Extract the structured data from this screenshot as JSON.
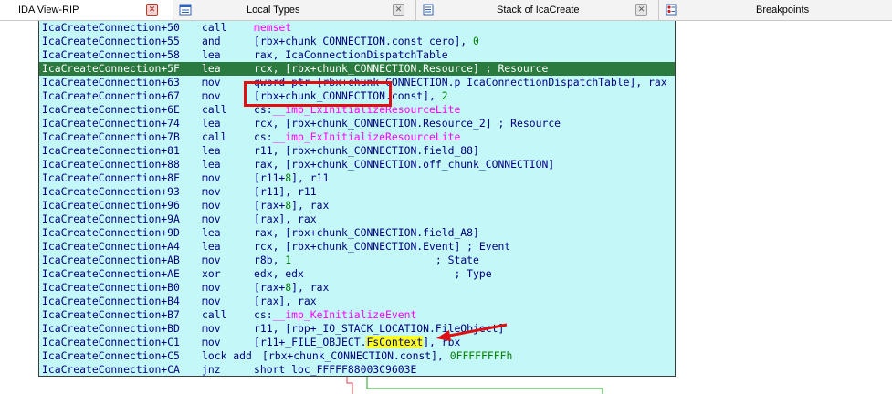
{
  "tabs": [
    {
      "label": "IDA View-RIP",
      "active": true,
      "icon": "none"
    },
    {
      "label": "Local Types",
      "active": false,
      "icon": "local-types-icon"
    },
    {
      "label": "Stack of IcaCreate",
      "active": false,
      "icon": "stack-icon"
    },
    {
      "label": "Breakpoints",
      "active": false,
      "icon": "breakpoints-icon"
    }
  ],
  "colors": {
    "node_bg": "#c4f8f8",
    "highlight": "#2b7a3f",
    "text": "#000080",
    "import": "#ff00ff",
    "number": "#008000",
    "marker": "#e01010"
  },
  "disasm": [
    {
      "addr": "IcaCreateConnection+50",
      "mnem": "call",
      "ops": [
        {
          "t": "memset",
          "c": "fn"
        }
      ]
    },
    {
      "addr": "IcaCreateConnection+55",
      "mnem": "and",
      "ops": [
        {
          "t": "[rbx+chunk_CONNECTION.const_cero], "
        },
        {
          "t": "0",
          "c": "num"
        }
      ]
    },
    {
      "addr": "IcaCreateConnection+58",
      "mnem": "lea",
      "ops": [
        {
          "t": "rax, IcaConnectionDispatchTable"
        }
      ]
    },
    {
      "addr": "IcaCreateConnection+5F",
      "mnem": "lea",
      "highlight": true,
      "ops": [
        {
          "t": "rcx, [rbx+chunk_CONNECTION.Resource] ; Resource"
        }
      ]
    },
    {
      "addr": "IcaCreateConnection+63",
      "mnem": "mov",
      "ops": [
        {
          "t": "qword ptr [rbx+chunk_CONNECTION.p_IcaConnectionDispatchTable], rax"
        }
      ]
    },
    {
      "addr": "IcaCreateConnection+67",
      "mnem": "mov",
      "ops": [
        {
          "t": "[rbx+chunk_CONNECTION.const], "
        },
        {
          "t": "2",
          "c": "num"
        }
      ]
    },
    {
      "addr": "IcaCreateConnection+6E",
      "mnem": "call",
      "ops": [
        {
          "t": "cs:"
        },
        {
          "t": "__imp_ExInitializeResourceLite",
          "c": "fn"
        }
      ]
    },
    {
      "addr": "IcaCreateConnection+74",
      "mnem": "lea",
      "ops": [
        {
          "t": "rcx, [rbx+chunk_CONNECTION.Resource_2] ; Resource"
        }
      ]
    },
    {
      "addr": "IcaCreateConnection+7B",
      "mnem": "call",
      "ops": [
        {
          "t": "cs:"
        },
        {
          "t": "__imp_ExInitializeResourceLite",
          "c": "fn"
        }
      ]
    },
    {
      "addr": "IcaCreateConnection+81",
      "mnem": "lea",
      "ops": [
        {
          "t": "r11, [rbx+chunk_CONNECTION.field_88]"
        }
      ]
    },
    {
      "addr": "IcaCreateConnection+88",
      "mnem": "lea",
      "ops": [
        {
          "t": "rax, [rbx+chunk_CONNECTION.off_chunk_CONNECTION]"
        }
      ]
    },
    {
      "addr": "IcaCreateConnection+8F",
      "mnem": "mov",
      "ops": [
        {
          "t": "[r11+"
        },
        {
          "t": "8",
          "c": "num"
        },
        {
          "t": "], r11"
        }
      ]
    },
    {
      "addr": "IcaCreateConnection+93",
      "mnem": "mov",
      "ops": [
        {
          "t": "[r11], r11"
        }
      ]
    },
    {
      "addr": "IcaCreateConnection+96",
      "mnem": "mov",
      "ops": [
        {
          "t": "[rax+"
        },
        {
          "t": "8",
          "c": "num"
        },
        {
          "t": "], rax"
        }
      ]
    },
    {
      "addr": "IcaCreateConnection+9A",
      "mnem": "mov",
      "ops": [
        {
          "t": "[rax], rax"
        }
      ]
    },
    {
      "addr": "IcaCreateConnection+9D",
      "mnem": "lea",
      "ops": [
        {
          "t": "rax, [rbx+chunk_CONNECTION.field_A8]"
        }
      ]
    },
    {
      "addr": "IcaCreateConnection+A4",
      "mnem": "lea",
      "ops": [
        {
          "t": "rcx, [rbx+chunk_CONNECTION.Event] ; Event"
        }
      ]
    },
    {
      "addr": "IcaCreateConnection+AB",
      "mnem": "mov",
      "ops": [
        {
          "t": "r8b, "
        },
        {
          "t": "1",
          "c": "num"
        },
        {
          "t": "                       ; State"
        }
      ]
    },
    {
      "addr": "IcaCreateConnection+AE",
      "mnem": "xor",
      "ops": [
        {
          "t": "edx, edx                        ; Type"
        }
      ]
    },
    {
      "addr": "IcaCreateConnection+B0",
      "mnem": "mov",
      "ops": [
        {
          "t": "[rax+"
        },
        {
          "t": "8",
          "c": "num"
        },
        {
          "t": "], rax"
        }
      ]
    },
    {
      "addr": "IcaCreateConnection+B4",
      "mnem": "mov",
      "ops": [
        {
          "t": "[rax], rax"
        }
      ]
    },
    {
      "addr": "IcaCreateConnection+B7",
      "mnem": "call",
      "ops": [
        {
          "t": "cs:"
        },
        {
          "t": "__imp_KeInitializeEvent",
          "c": "fn"
        }
      ]
    },
    {
      "addr": "IcaCreateConnection+BD",
      "mnem": "mov",
      "ops": [
        {
          "t": "r11, [rbp+_IO_STACK_LOCATION.FileObject]"
        }
      ]
    },
    {
      "addr": "IcaCreateConnection+C1",
      "mnem": "mov",
      "ops": [
        {
          "t": "[r11+_FILE_OBJECT."
        },
        {
          "t": "FsContext",
          "c": "fs"
        },
        {
          "t": "], rbx"
        }
      ]
    },
    {
      "addr": "IcaCreateConnection+C5",
      "mnem": "lock add",
      "joined": true,
      "ops": [
        {
          "t": "[rbx+chunk_CONNECTION.const], "
        },
        {
          "t": "0FFFFFFFFh",
          "c": "num"
        }
      ]
    },
    {
      "addr": "IcaCreateConnection+CA",
      "mnem": "jnz",
      "ops": [
        {
          "t": "short loc_FFFFF88003C9603E"
        }
      ]
    }
  ]
}
